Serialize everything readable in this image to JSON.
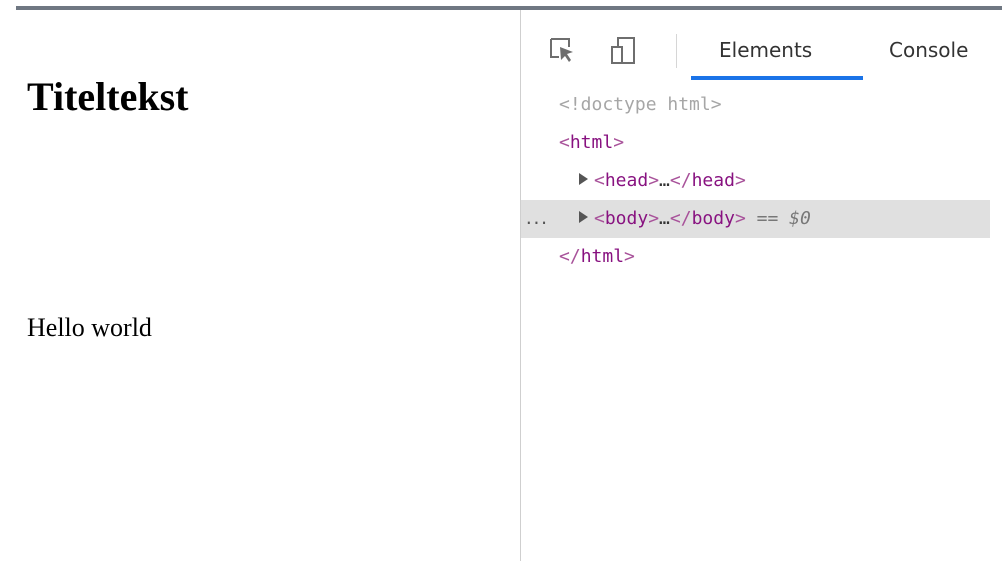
{
  "page": {
    "title": "Titeltekst",
    "paragraph": "Hello world"
  },
  "devtools": {
    "toolbar": {
      "inspect_icon": "inspect-element-icon",
      "device_icon": "device-toolbar-icon"
    },
    "tabs": [
      {
        "label": "Elements",
        "active": true
      },
      {
        "label": "Console",
        "active": false
      }
    ],
    "accent_color": "#1a73e8",
    "dom": {
      "doctype": "<!doctype html>",
      "html_open": "html",
      "head_tag": "head",
      "body_tag": "body",
      "ellipsis": "…",
      "selected_ref": "== $0",
      "row_dots": "...",
      "html_close": "html"
    }
  }
}
